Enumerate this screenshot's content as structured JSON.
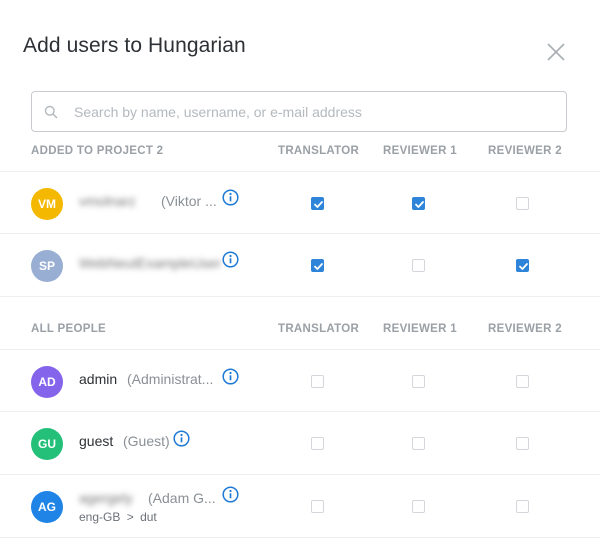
{
  "dialog": {
    "title": "Add users to Hungarian",
    "close_icon": "close-icon"
  },
  "search": {
    "placeholder": "Search by name, username, or e-mail address",
    "value": "",
    "icon": "search-icon"
  },
  "project_section": {
    "heading": "ADDED TO PROJECT 2",
    "columns": [
      "TRANSLATOR",
      "REVIEWER 1",
      "REVIEWER 2"
    ],
    "rows": [
      {
        "initials": "VM",
        "avatar_color": "#f5b800",
        "username": "vmolnarz",
        "fullname": "(Viktor ...",
        "translator": true,
        "reviewer1": true,
        "reviewer2": false
      },
      {
        "initials": "SP",
        "avatar_color": "#98aed2",
        "username": "WebNeutExampleUser",
        "fullname": "",
        "translator": true,
        "reviewer1": false,
        "reviewer2": true
      }
    ]
  },
  "people_section": {
    "heading": "ALL PEOPLE",
    "columns": [
      "TRANSLATOR",
      "REVIEWER 1",
      "REVIEWER 2"
    ],
    "rows": [
      {
        "initials": "AD",
        "avatar_color": "#8464ea",
        "username": "admin",
        "fullname": "(Administrat...",
        "translator": false,
        "reviewer1": false,
        "reviewer2": false
      },
      {
        "initials": "GU",
        "avatar_color": "#24c07a",
        "username": "guest",
        "fullname": "(Guest)",
        "translator": false,
        "reviewer1": false,
        "reviewer2": false
      },
      {
        "initials": "AG",
        "avatar_color": "#1f84e6",
        "username": "agergely",
        "fullname": "(Adam G...",
        "sub_source": "eng-GB",
        "sub_arrow": ">",
        "sub_target": "dut",
        "translator": false,
        "reviewer1": false,
        "reviewer2": false
      }
    ]
  },
  "colors": {
    "accent": "#2d84d8",
    "info_icon": "#1f7ad6",
    "header_text": "#9aa0a6"
  }
}
